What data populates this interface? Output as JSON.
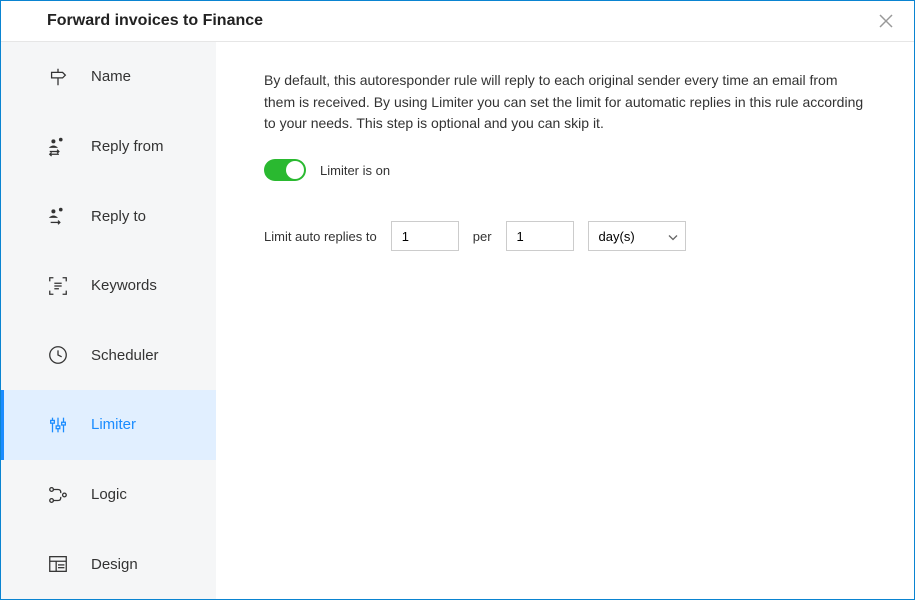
{
  "header": {
    "title": "Forward invoices to Finance"
  },
  "sidebar": {
    "items": [
      {
        "label": "Name"
      },
      {
        "label": "Reply from"
      },
      {
        "label": "Reply to"
      },
      {
        "label": "Keywords"
      },
      {
        "label": "Scheduler"
      },
      {
        "label": "Limiter"
      },
      {
        "label": "Logic"
      },
      {
        "label": "Design"
      }
    ]
  },
  "content": {
    "description": "By default, this autoresponder rule will reply to each original sender every time an email from them is received. By using Limiter you can set the limit for automatic replies in this rule according to your needs. This step is optional and you can skip it.",
    "toggle_label": "Limiter is on",
    "limit_prefix": "Limit auto replies to",
    "limit_count": "1",
    "limit_per_label": "per",
    "limit_per_value": "1",
    "limit_unit": "day(s)"
  }
}
